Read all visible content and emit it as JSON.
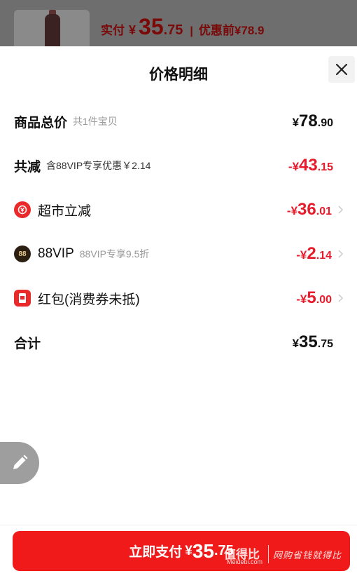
{
  "backdrop": {
    "paid_label": "实付",
    "currency": "¥",
    "price_int": "35",
    "price_dec": ".75",
    "separator": "|",
    "original_label": "优惠前",
    "original_price": "¥78.9"
  },
  "sheet": {
    "title": "价格明细",
    "close_icon": "close-icon"
  },
  "rows": {
    "subtotal": {
      "name": "商品总价",
      "sub": "共1件宝贝",
      "yen": "¥",
      "int": "78",
      "dec": ".90"
    },
    "discount_total": {
      "name": "共减",
      "sub": "含88VIP专享优惠￥2.14",
      "yen": "-¥",
      "int": "43",
      "dec": ".15"
    },
    "market": {
      "icon": "supermarket-icon",
      "name": "超市立减",
      "yen": "-¥",
      "int": "36",
      "dec": ".01"
    },
    "vip": {
      "icon": "vip-badge-icon",
      "icon_text": "88",
      "name": "88VIP",
      "sub": "88VIP专享9.5折",
      "yen": "-¥",
      "int": "2",
      "dec": ".14"
    },
    "redpacket": {
      "icon": "red-packet-icon",
      "name": "红包(消费券未抵)",
      "yen": "-¥",
      "int": "5",
      "dec": ".00"
    },
    "total": {
      "name": "合计",
      "yen": "¥",
      "int": "35",
      "dec": ".75"
    }
  },
  "pay": {
    "label": "立即支付",
    "yen": "¥",
    "int": "35",
    "dec": ".75"
  },
  "watermark": {
    "logo": "值得比",
    "site": "Meidebi.com",
    "slogan": "网购省钱就得比"
  },
  "colors": {
    "accent_red": "#e61b2b",
    "button_red": "#f01a1a"
  }
}
